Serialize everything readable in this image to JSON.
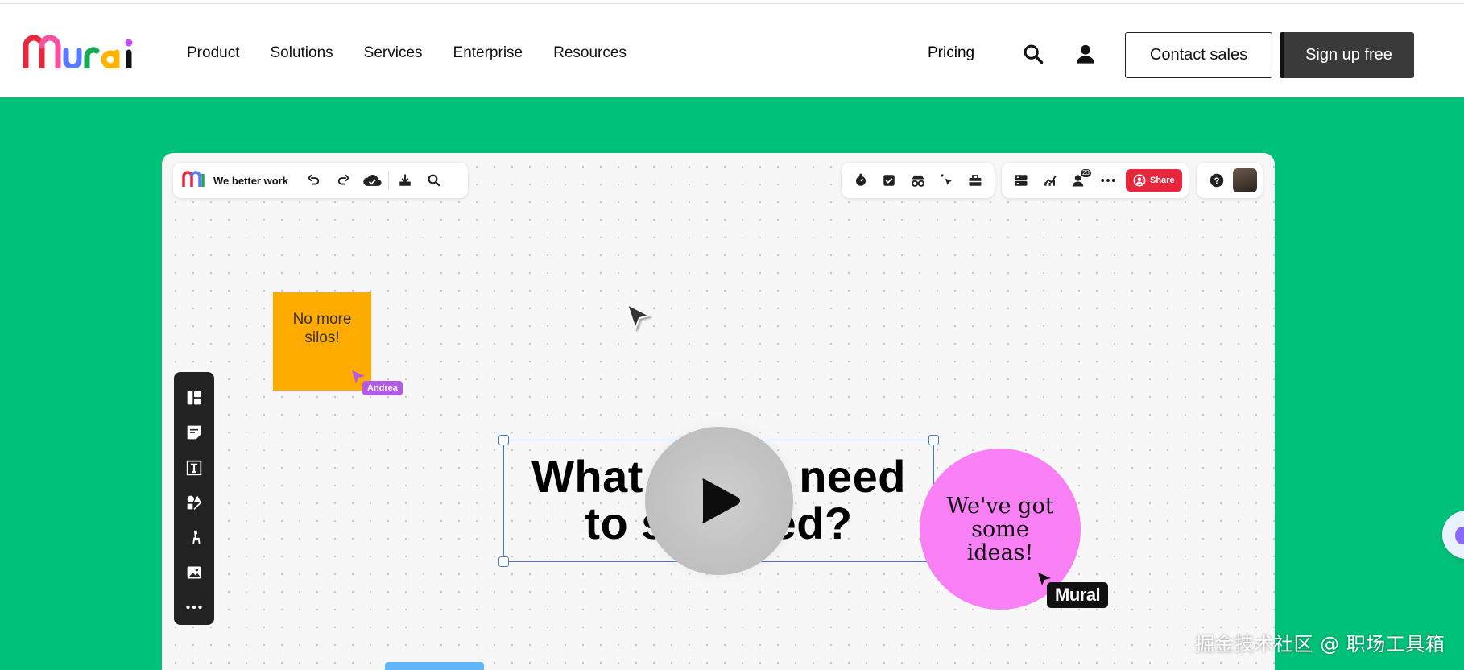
{
  "nav": {
    "logo_text": "Mural",
    "links": [
      "Product",
      "Solutions",
      "Services",
      "Enterprise",
      "Resources"
    ],
    "pricing": "Pricing",
    "contact_sales": "Contact sales",
    "sign_up": "Sign up free"
  },
  "board": {
    "title": "We better work",
    "share_label": "Share",
    "notification_count": "23",
    "sticky_note": "No more silos!",
    "andrea_label": "Andrea",
    "question_line1": "What do we need",
    "question_line2": "to succeed?",
    "circle_text": "We've got some ideas!",
    "mural_cursor_label": "Mural"
  },
  "watermark": "掘金技术社区 @ 职场工具箱",
  "colors": {
    "hero_green": "#00c17a",
    "sticky_orange": "#ffab00",
    "circle_pink": "#f97ff5",
    "share_red": "#e8273d",
    "selection_blue": "#4a78c8",
    "andrea_purple": "#b259e8"
  },
  "icons": {
    "nav": [
      "search-icon",
      "user-icon"
    ],
    "toolbar_left": [
      "undo-icon",
      "redo-icon",
      "cloud-check-icon",
      "download-icon",
      "search-icon"
    ],
    "toolbar_mid": [
      "timer-icon",
      "checkbox-icon",
      "spy-icon",
      "cursor-click-icon",
      "toolbox-icon"
    ],
    "toolbar_right": [
      "outline-icon",
      "activity-icon",
      "members-icon",
      "more-icon"
    ],
    "sidebar": [
      "templates-icon",
      "sticky-note-icon",
      "text-icon",
      "shapes-icon",
      "llama-icon",
      "image-icon",
      "more-icon"
    ]
  }
}
